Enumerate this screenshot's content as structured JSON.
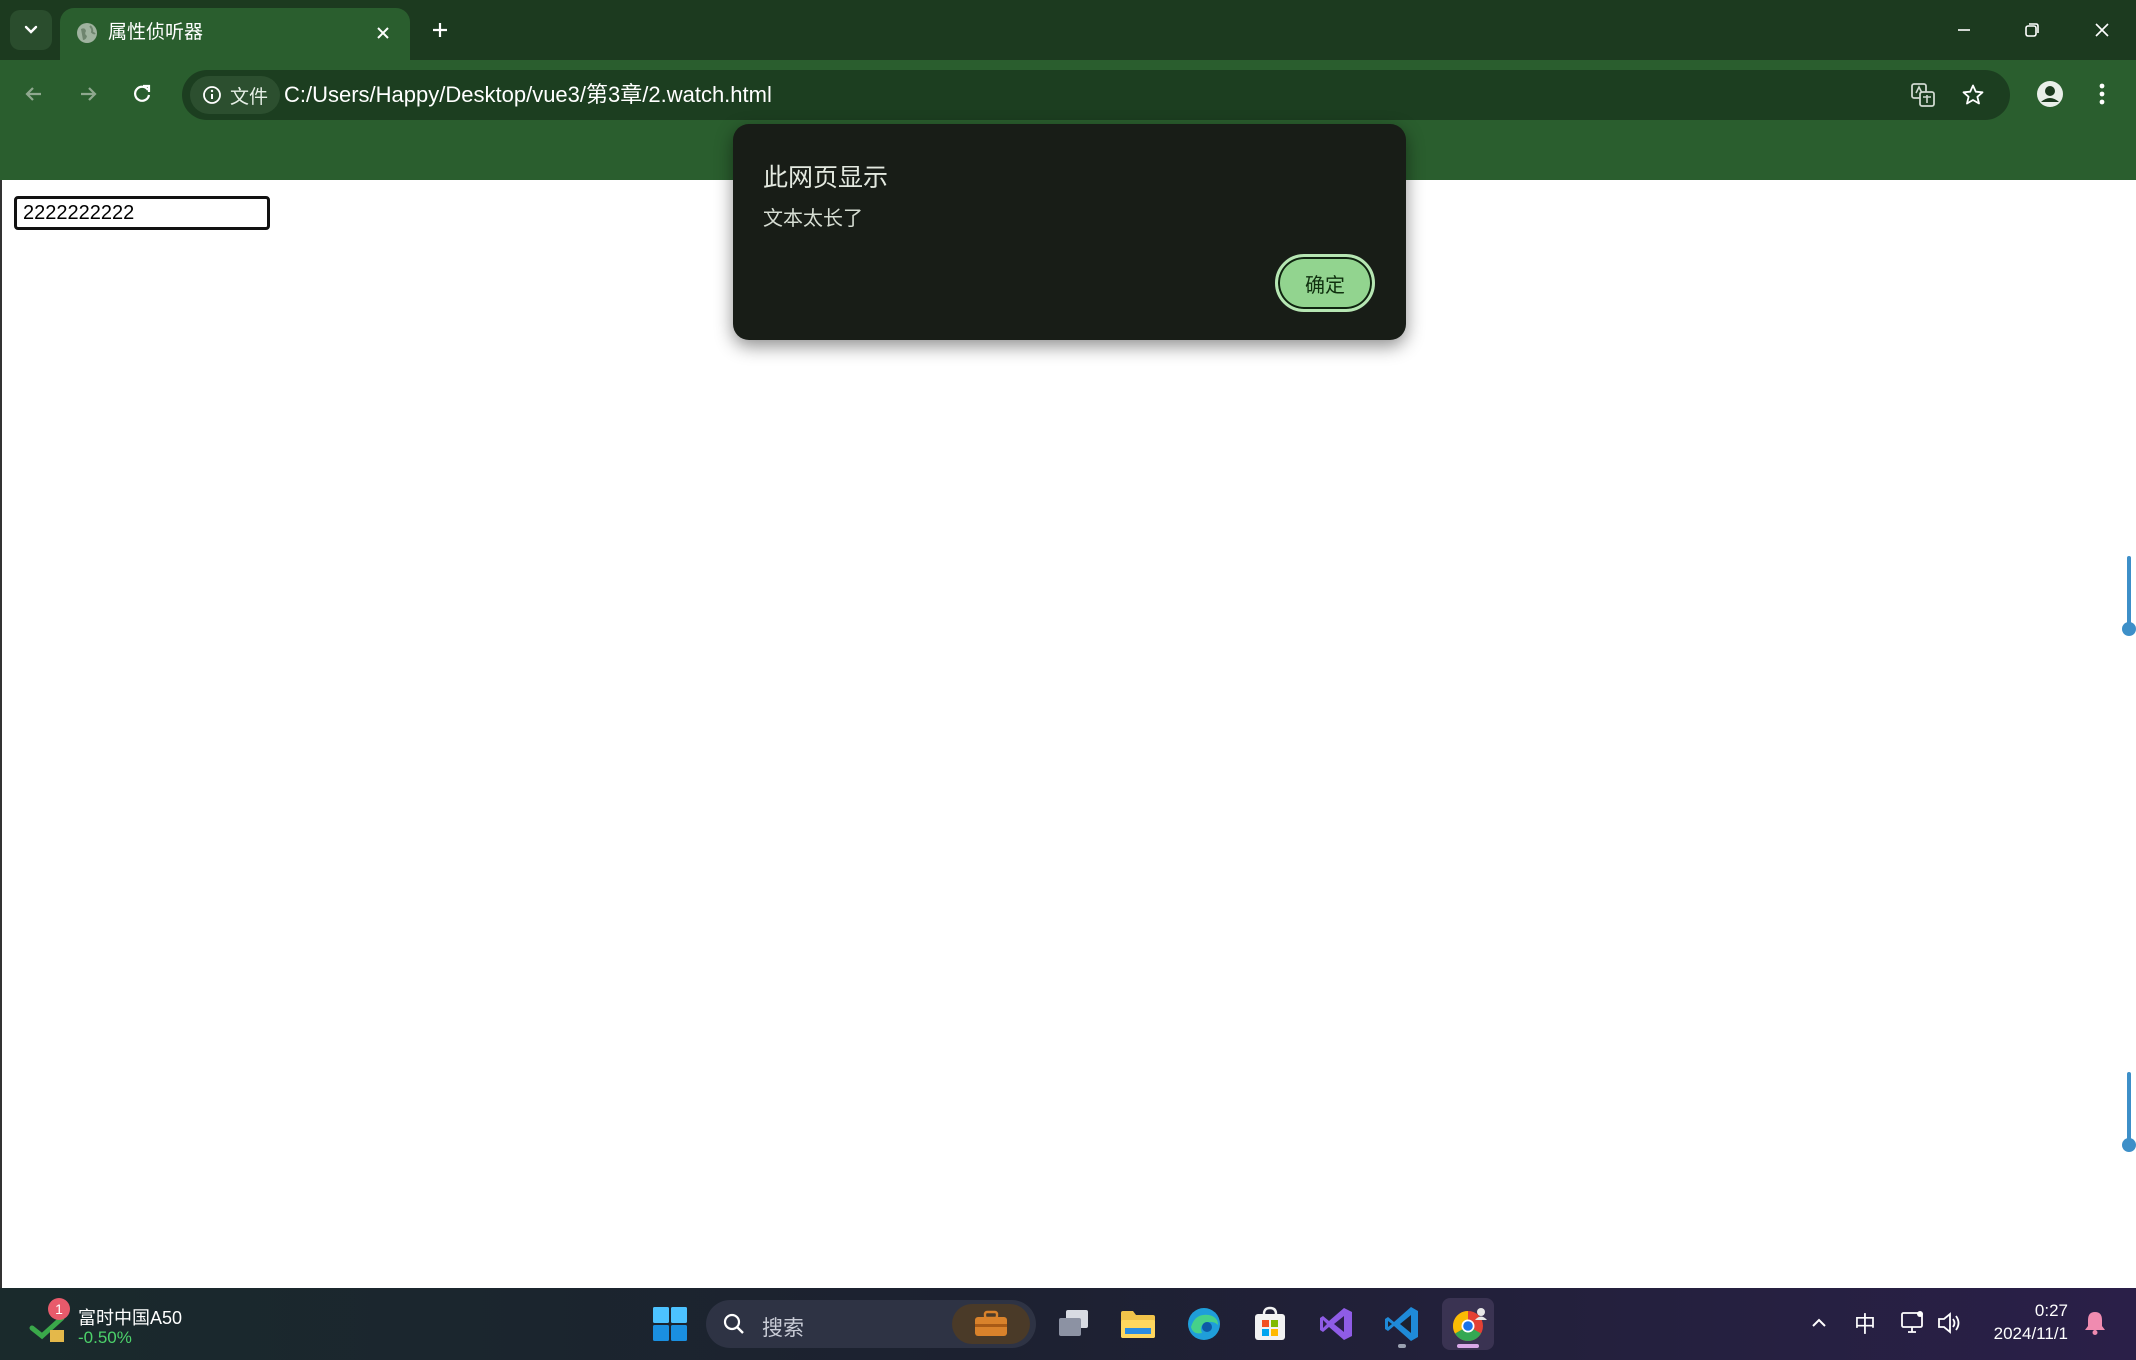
{
  "browser": {
    "tab": {
      "title": "属性侦听器"
    },
    "address_bar": {
      "site_info_label": "文件",
      "url": "C:/Users/Happy/Desktop/vue3/第3章/2.watch.html"
    }
  },
  "page": {
    "text_input_value": "2222222222"
  },
  "dialog": {
    "title": "此网页显示",
    "message": "文本太长了",
    "ok_label": "确定"
  },
  "taskbar": {
    "widget": {
      "badge": "1",
      "title": "富时中国A50",
      "change": "-0.50%"
    },
    "search_placeholder": "搜索",
    "ime_indicator": "中",
    "clock": {
      "time": "0:27",
      "date": "2024/11/1"
    }
  },
  "colors": {
    "chrome_dark": "#1c3a1f",
    "chrome_toolbar": "#2a5e2e",
    "dialog_bg": "#181d17",
    "dialog_button": "#92d48f",
    "stock_change": "#4cd26a"
  }
}
